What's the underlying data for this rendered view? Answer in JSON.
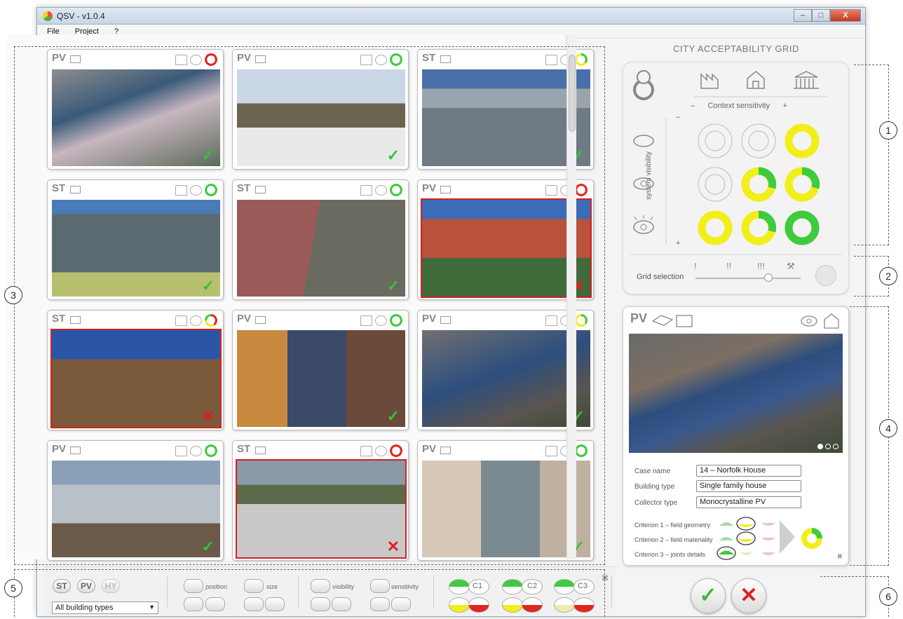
{
  "window": {
    "title": "QSV - v1.0.4",
    "min": "–",
    "max": "□",
    "close": "X"
  },
  "menu": [
    "File",
    "Project",
    "?"
  ],
  "cards": [
    {
      "type": "PV",
      "status": "ok",
      "ring": "red-ring",
      "view": "eye-closed",
      "ctx": "factory"
    },
    {
      "type": "PV",
      "status": "ok",
      "ring": "green-ring",
      "view": "eye",
      "ctx": "factory"
    },
    {
      "type": "ST",
      "status": "ok",
      "ring": "yellow-green-ring",
      "view": "eye",
      "ctx": "house"
    },
    {
      "type": "ST",
      "status": "ok",
      "ring": "green-ring",
      "view": "eye",
      "ctx": "house"
    },
    {
      "type": "ST",
      "status": "ok",
      "ring": "green-ring",
      "view": "eye",
      "ctx": "house"
    },
    {
      "type": "PV",
      "status": "no",
      "ring": "red-ring",
      "view": "eye-open",
      "ctx": "house"
    },
    {
      "type": "ST",
      "status": "no",
      "ring": "multi-ring",
      "view": "eye",
      "ctx": "monument"
    },
    {
      "type": "PV",
      "status": "ok",
      "ring": "green-ring",
      "view": "eye",
      "ctx": "house"
    },
    {
      "type": "PV",
      "status": "ok",
      "ring": "yellow-green-ring",
      "view": "eye-open",
      "ctx": "house"
    },
    {
      "type": "PV",
      "status": "ok",
      "ring": "green-ring",
      "view": "eye-closed",
      "ctx": "monument"
    },
    {
      "type": "ST",
      "status": "no",
      "ring": "red-ring",
      "view": "eye-open",
      "ctx": "monument"
    },
    {
      "type": "PV",
      "status": "ok",
      "ring": "green-ring",
      "view": "eye-open",
      "ctx": "monument"
    }
  ],
  "marks": {
    "ok": "✓",
    "no": "✕"
  },
  "grid": {
    "title": "CITY ACCEPTABILITY GRID",
    "context_label": "Context sensitivity",
    "minus": "–",
    "plus": "+",
    "visibility_label": "system visibility",
    "selection_label": "Grid selection",
    "levels": [
      "!",
      "!!",
      "!!!"
    ]
  },
  "detail": {
    "type": "PV",
    "fields": [
      {
        "label": "Case name",
        "value": "14 – Norfolk House"
      },
      {
        "label": "Building type",
        "value": "Single family house"
      },
      {
        "label": "Collector type",
        "value": "Monocrystalline PV"
      }
    ],
    "criteria": [
      "Criterion 1 – field geometry",
      "Criterion 2 – field materiality",
      "Criterion 3 – joints details"
    ],
    "close": "✖"
  },
  "filters": {
    "types": [
      "ST",
      "PV",
      "HY"
    ],
    "position": "position",
    "size": "size",
    "visibility": "visibility",
    "sensitivity": "sensitivity",
    "c1": "C1",
    "c2": "C2",
    "c3": "C3",
    "building_select": "All building types",
    "close": "⌘"
  },
  "actions": {
    "confirm": "✓",
    "reject": "✕"
  },
  "callouts": [
    "1",
    "2",
    "3",
    "4",
    "5",
    "6"
  ],
  "colors": {
    "green": "#3ecb3e",
    "yellow": "#f2ee1a",
    "red": "#e2261f",
    "accent": "#d42020"
  }
}
